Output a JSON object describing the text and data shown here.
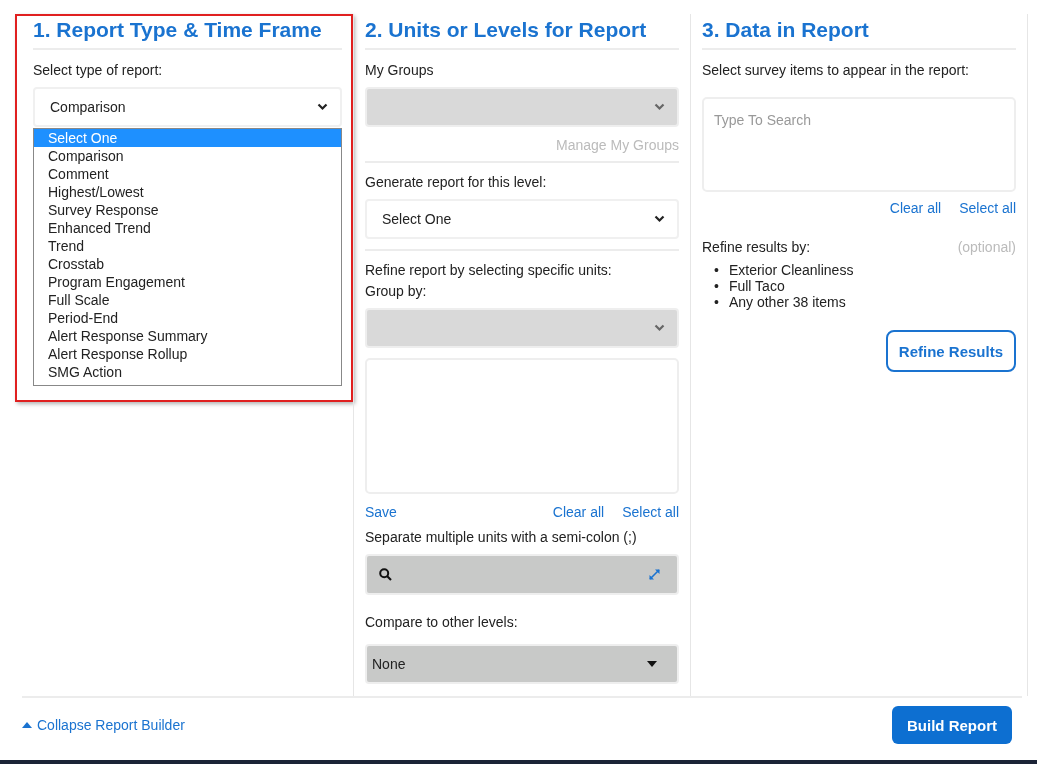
{
  "sections": [
    {
      "title": "1.  Report Type & Time Frame",
      "highlighted": true,
      "label": "Select type of report:",
      "select": {
        "value": "Comparison",
        "expanded": true
      },
      "options": [
        {
          "label": "Select One",
          "selected": true
        },
        {
          "label": "Comparison",
          "selected": false
        },
        {
          "label": "Comment",
          "selected": false
        },
        {
          "label": "Highest/Lowest",
          "selected": false
        },
        {
          "label": "Survey Response",
          "selected": false
        },
        {
          "label": "Enhanced Trend",
          "selected": false
        },
        {
          "label": "Trend",
          "selected": false
        },
        {
          "label": "Crosstab",
          "selected": false
        },
        {
          "label": "Program Engagement",
          "selected": false
        },
        {
          "label": "Full Scale",
          "selected": false
        },
        {
          "label": "Period-End",
          "selected": false
        },
        {
          "label": "Alert Response Summary",
          "selected": false
        },
        {
          "label": "Alert Response Rollup",
          "selected": false
        },
        {
          "label": "SMG Action",
          "selected": false
        }
      ]
    },
    {
      "title": "2. Units or Levels for Report",
      "highlighted": false,
      "my_groups": {
        "label": "My Groups",
        "disabled": true,
        "manage_link": "Manage My Groups"
      },
      "level": {
        "label": "Generate report for this level:",
        "value": "Select One"
      },
      "refine": {
        "label": "Refine report by selecting specific units:",
        "group_by": "Group by:",
        "disabled": true
      },
      "links": {
        "save": "Save",
        "clear": "Clear all",
        "select": "Select all"
      },
      "separate_label": "Separate multiple units with a semi-colon (;)",
      "compare": {
        "label": "Compare to other levels:",
        "value": "None"
      }
    },
    {
      "title": "3. Data in Report",
      "highlighted": false,
      "label": "Select survey items to appear in the report:",
      "search": {
        "placeholder": "Type To Search"
      },
      "links": {
        "clear": "Clear all",
        "select": "Select all"
      },
      "refine_label": "Refine results by:",
      "optional": "(optional)",
      "items": [
        {
          "bullet": "•",
          "text": "Exterior Cleanliness"
        },
        {
          "bullet": "•",
          "text": "Full Taco"
        },
        {
          "bullet": "•",
          "text": "Any other 38 items"
        }
      ],
      "button": "Refine Results"
    }
  ],
  "footer": {
    "collapse": "Collapse Report Builder",
    "build": "Build Report"
  }
}
